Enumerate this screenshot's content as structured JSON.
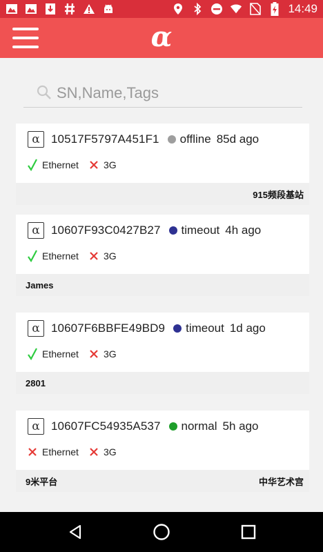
{
  "status_bar": {
    "time": "14:49",
    "icons": [
      "image-icon",
      "image-icon",
      "download-icon",
      "hash-icon",
      "warning-icon",
      "android-icon",
      "location-icon",
      "bluetooth-icon",
      "do-not-disturb-icon",
      "wifi-icon",
      "no-sim-icon",
      "battery-charging-icon"
    ]
  },
  "app_bar": {
    "logo": "α",
    "menu_icon": "menu-icon"
  },
  "search": {
    "placeholder": "SN,Name,Tags",
    "value": ""
  },
  "devices": [
    {
      "sn": "10517F5797A451F1",
      "status": "offline",
      "status_color": "#9e9e9e",
      "ago": "85d ago",
      "ethernet_ok": true,
      "ethernet_label": "Ethernet",
      "g3_ok": false,
      "g3_label": "3G",
      "tag_left": "",
      "tag_right": "915频段基站"
    },
    {
      "sn": "10607F93C0427B27",
      "status": "timeout",
      "status_color": "#2e3192",
      "ago": "4h ago",
      "ethernet_ok": true,
      "ethernet_label": "Ethernet",
      "g3_ok": false,
      "g3_label": "3G",
      "tag_left": "James",
      "tag_right": ""
    },
    {
      "sn": "10607F6BBFE49BD9",
      "status": "timeout",
      "status_color": "#2e3192",
      "ago": "1d ago",
      "ethernet_ok": true,
      "ethernet_label": "Ethernet",
      "g3_ok": false,
      "g3_label": "3G",
      "tag_left": "2801",
      "tag_right": ""
    },
    {
      "sn": "10607FC54935A537",
      "status": "normal",
      "status_color": "#1e9e2a",
      "ago": "5h ago",
      "ethernet_ok": false,
      "ethernet_label": "Ethernet",
      "g3_ok": false,
      "g3_label": "3G",
      "tag_left": "9米平台",
      "tag_right": "中华艺术宫"
    }
  ],
  "colors": {
    "status_bar": "#d92f3a",
    "app_bar": "#f05252",
    "check": "#2ecc40",
    "cross": "#e53935"
  },
  "nav_bar": {
    "icons": [
      "back-icon",
      "home-icon",
      "recents-icon"
    ]
  }
}
